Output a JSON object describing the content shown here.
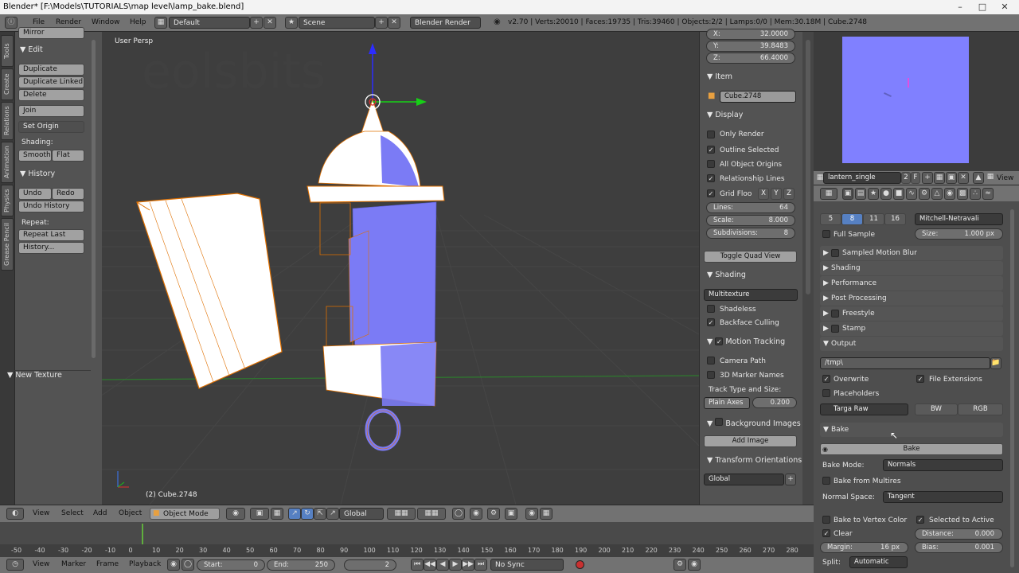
{
  "window": {
    "title": "Blender* [F:\\Models\\TUTORIALS\\map level\\lamp_bake.blend]"
  },
  "menubar": {
    "items": [
      "File",
      "Render",
      "Window",
      "Help"
    ],
    "layout": "Default",
    "scene": "Scene",
    "engine": "Blender Render",
    "stats": "v2.70 | Verts:20010 | Faces:19735 | Tris:39460 | Objects:2/2 | Lamps:0/0 | Mem:30.18M | Cube.2748"
  },
  "tool_tabs": [
    "Tools",
    "Create",
    "Relations",
    "Animation",
    "Physics",
    "Grease Pencil"
  ],
  "toolshelf": {
    "mirror": "Mirror",
    "edit_title": "Edit",
    "duplicate": "Duplicate",
    "duplicate_linked": "Duplicate Linked",
    "delete": "Delete",
    "join": "Join",
    "set_origin": "Set Origin",
    "shading_label": "Shading:",
    "smooth": "Smooth",
    "flat": "Flat",
    "history_title": "History",
    "undo": "Undo",
    "redo": "Redo",
    "undo_history": "Undo History",
    "repeat_label": "Repeat:",
    "repeat_last": "Repeat Last",
    "history": "History...",
    "new_texture": "New Texture"
  },
  "viewport": {
    "label": "User Persp",
    "object_label": "(2) Cube.2748",
    "watermark": "eolsbits"
  },
  "npanel": {
    "x": "32.0000",
    "y": "39.8483",
    "z": "66.4000",
    "item_title": "Item",
    "item_name": "Cube.2748",
    "display_title": "Display",
    "only_render": "Only Render",
    "outline_selected": "Outline Selected",
    "all_origins": "All Object Origins",
    "relationship_lines": "Relationship Lines",
    "grid_floor": "Grid Floo",
    "lines_label": "Lines:",
    "lines": "64",
    "scale_label": "Scale:",
    "scale": "8.000",
    "subdiv_label": "Subdivisions:",
    "subdiv": "8",
    "toggle_quad": "Toggle Quad View",
    "shading_title": "Shading",
    "multitexture": "Multitexture",
    "shadeless": "Shadeless",
    "backface": "Backface Culling",
    "motion_title": "Motion Tracking",
    "camera_path": "Camera Path",
    "marker_names": "3D Marker Names",
    "track_type_label": "Track Type and Size:",
    "plain_axes": "Plain Axes",
    "track_size": "0.200",
    "bg_title": "Background Images",
    "add_image": "Add Image",
    "transform_title": "Transform Orientations",
    "global": "Global"
  },
  "properties": {
    "image_name": "lantern_single",
    "users": "2",
    "view": "View",
    "samples": [
      "5",
      "8",
      "11",
      "16"
    ],
    "filter": "Mitchell-Netravali",
    "full_sample": "Full Sample",
    "size_label": "Size:",
    "size": "1.000 px",
    "panels": [
      "Sampled Motion Blur",
      "Shading",
      "Performance",
      "Post Processing",
      "Freestyle",
      "Stamp"
    ],
    "output_title": "Output",
    "path": "/tmp\\",
    "overwrite": "Overwrite",
    "file_ext": "File Extensions",
    "placeholders": "Placeholders",
    "format": "Targa Raw",
    "bw": "BW",
    "rgb": "RGB",
    "bake_title": "Bake",
    "bake_btn": "Bake",
    "bake_mode_label": "Bake Mode:",
    "bake_mode": "Normals",
    "bake_multires": "Bake from Multires",
    "normal_space_label": "Normal Space:",
    "normal_space": "Tangent",
    "bake_vertex": "Bake to Vertex Color",
    "selected_active": "Selected to Active",
    "clear": "Clear",
    "distance_label": "Distance:",
    "distance": "0.000",
    "margin_label": "Margin:",
    "margin": "16 px",
    "bias_label": "Bias:",
    "bias": "0.001",
    "split_label": "Split:",
    "split": "Automatic"
  },
  "view_header": {
    "menus": [
      "View",
      "Select",
      "Add",
      "Object"
    ],
    "mode": "Object Mode",
    "orientation": "Global"
  },
  "timeline": {
    "ticks": [
      "-50",
      "-40",
      "-30",
      "-20",
      "-10",
      "0",
      "10",
      "20",
      "30",
      "40",
      "50",
      "60",
      "70",
      "80",
      "90",
      "100",
      "110",
      "120",
      "130",
      "140",
      "150",
      "160",
      "170",
      "180",
      "190",
      "200",
      "210",
      "220",
      "230",
      "240",
      "250",
      "260",
      "270",
      "280"
    ],
    "menus": [
      "View",
      "Marker",
      "Frame",
      "Playback"
    ],
    "start_label": "Start:",
    "start": "0",
    "end_label": "End:",
    "end": "250",
    "current": "2",
    "sync": "No Sync"
  }
}
